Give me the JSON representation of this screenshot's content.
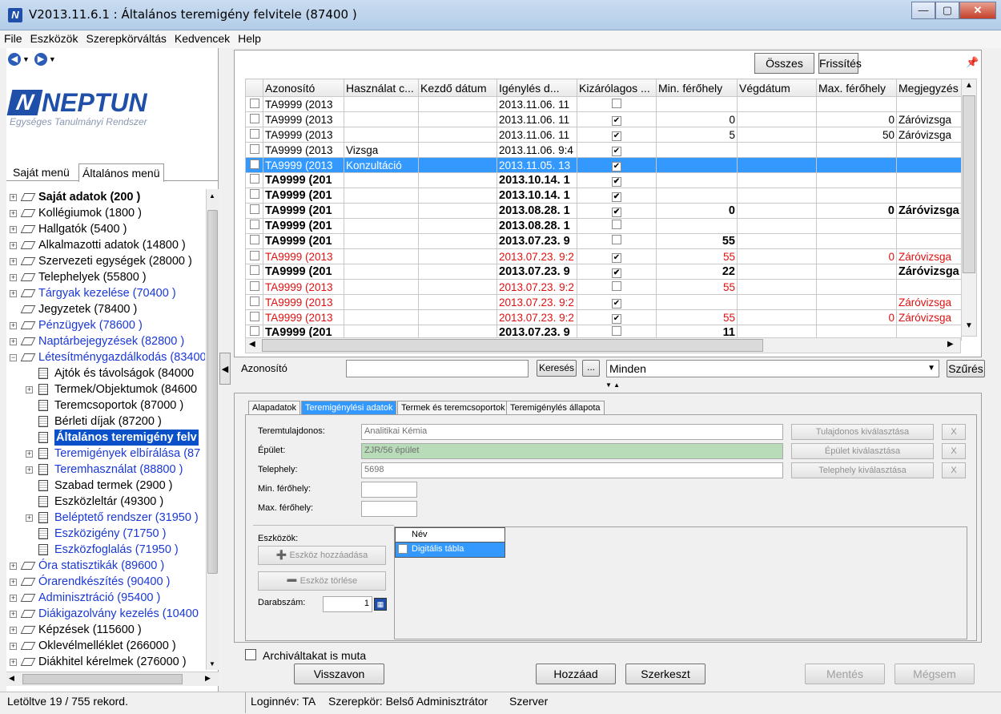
{
  "window": {
    "title": "V2013.11.6.1 : Általános teremigény felvitele (87400  )",
    "minimize": "—",
    "maximize": "▢",
    "close": "✕"
  },
  "menu": [
    "File",
    "Eszközök",
    "Szerepkörváltás",
    "Kedvencek",
    "Help"
  ],
  "logo": {
    "name": "NEPTUN",
    "subtitle": "Egységes Tanulmányi Rendszer"
  },
  "menu_tabs": {
    "own": "Saját menü",
    "general": "Általános menü"
  },
  "tree": [
    {
      "label": "Saját adatok (200  )",
      "style": "bold",
      "level": 0,
      "plus": true,
      "icon": "dia"
    },
    {
      "label": "Kollégiumok (1800  )",
      "style": "",
      "level": 0,
      "plus": true,
      "icon": "dia"
    },
    {
      "label": "Hallgatók (5400  )",
      "style": "",
      "level": 0,
      "plus": true,
      "icon": "dia"
    },
    {
      "label": "Alkalmazotti adatok (14800  )",
      "style": "",
      "level": 0,
      "plus": true,
      "icon": "dia"
    },
    {
      "label": "Szervezeti egységek (28000  )",
      "style": "",
      "level": 0,
      "plus": true,
      "icon": "dia"
    },
    {
      "label": "Telephelyek (55800  )",
      "style": "",
      "level": 0,
      "plus": true,
      "icon": "dia"
    },
    {
      "label": "Tárgyak kezelése (70400  )",
      "style": "blue",
      "level": 0,
      "plus": true,
      "icon": "dia"
    },
    {
      "label": "Jegyzetek (78400  )",
      "style": "",
      "level": 0,
      "plus": false,
      "icon": "dia"
    },
    {
      "label": "Pénzügyek (78600  )",
      "style": "blue",
      "level": 0,
      "plus": true,
      "icon": "dia"
    },
    {
      "label": "Naptárbejegyzések (82800  )",
      "style": "blue",
      "level": 0,
      "plus": true,
      "icon": "dia"
    },
    {
      "label": "Létesítménygazdálkodás (83400",
      "style": "blue",
      "level": 0,
      "plus": true,
      "icon": "dia",
      "open": true
    },
    {
      "label": "Ajtók és távolságok (84000",
      "style": "",
      "level": 1,
      "plus": false,
      "icon": "doc"
    },
    {
      "label": "Termek/Objektumok (84600",
      "style": "",
      "level": 1,
      "plus": true,
      "icon": "doc"
    },
    {
      "label": "Teremcsoportok (87000  )",
      "style": "",
      "level": 1,
      "plus": false,
      "icon": "doc"
    },
    {
      "label": "Bérleti díjak (87200  )",
      "style": "",
      "level": 1,
      "plus": false,
      "icon": "doc"
    },
    {
      "label": "Általános teremigény felv",
      "style": "sel",
      "level": 1,
      "plus": false,
      "icon": "doc"
    },
    {
      "label": "Teremigények elbírálása (87",
      "style": "blue",
      "level": 1,
      "plus": true,
      "icon": "doc"
    },
    {
      "label": "Teremhasználat (88800  )",
      "style": "blue",
      "level": 1,
      "plus": true,
      "icon": "doc"
    },
    {
      "label": "Szabad termek (2900  )",
      "style": "",
      "level": 1,
      "plus": false,
      "icon": "doc"
    },
    {
      "label": "Eszközleltár (49300  )",
      "style": "",
      "level": 1,
      "plus": false,
      "icon": "doc"
    },
    {
      "label": "Beléptető rendszer (31950  )",
      "style": "blue",
      "level": 1,
      "plus": true,
      "icon": "doc"
    },
    {
      "label": "Eszközigény (71750  )",
      "style": "blue",
      "level": 1,
      "plus": false,
      "icon": "doc"
    },
    {
      "label": "Eszközfoglalás (71950  )",
      "style": "blue",
      "level": 1,
      "plus": false,
      "icon": "doc"
    },
    {
      "label": "Óra statisztikák (89600  )",
      "style": "blue",
      "level": 0,
      "plus": true,
      "icon": "dia"
    },
    {
      "label": "Órarendkészítés (90400  )",
      "style": "blue",
      "level": 0,
      "plus": true,
      "icon": "dia"
    },
    {
      "label": "Adminisztráció (95400  )",
      "style": "blue",
      "level": 0,
      "plus": true,
      "icon": "dia"
    },
    {
      "label": "Diákigazolvány kezelés (10400",
      "style": "blue",
      "level": 0,
      "plus": true,
      "icon": "dia"
    },
    {
      "label": "Képzések (115600  )",
      "style": "",
      "level": 0,
      "plus": true,
      "icon": "dia"
    },
    {
      "label": "Oklevélmelléklet (266000  )",
      "style": "",
      "level": 0,
      "plus": true,
      "icon": "dia"
    },
    {
      "label": "Diákhitel kérelmek (276000  )",
      "style": "",
      "level": 0,
      "plus": true,
      "icon": "dia"
    }
  ],
  "grid": {
    "buttons": {
      "all": "Összes ada",
      "refresh": "Frissítés"
    },
    "columns": [
      "Azonosító",
      "Használat c...",
      "Kezdő dátum",
      "Igénylés d...",
      "Kizárólagos ...",
      "Min. férőhely",
      "Végdátum",
      "Max. férőhely",
      "Megjegyzés"
    ],
    "rows": [
      {
        "id": "TA9999 (2013",
        "use": "",
        "start": "",
        "req": "2013.11.06. 11",
        "excl": false,
        "min": "",
        "end": "",
        "max": "",
        "note": "",
        "style": ""
      },
      {
        "id": "TA9999 (2013",
        "use": "",
        "start": "",
        "req": "2013.11.06. 11",
        "excl": true,
        "min": "0",
        "end": "",
        "max": "0",
        "note": "Záróvizsga",
        "style": ""
      },
      {
        "id": "TA9999 (2013",
        "use": "",
        "start": "",
        "req": "2013.11.06. 11",
        "excl": true,
        "min": "5",
        "end": "",
        "max": "50",
        "note": "Záróvizsga",
        "style": ""
      },
      {
        "id": "TA9999 (2013",
        "use": "Vizsga",
        "start": "",
        "req": "2013.11.06. 9:4",
        "excl": true,
        "min": "",
        "end": "",
        "max": "",
        "note": "",
        "style": ""
      },
      {
        "id": "TA9999 (2013",
        "use": "Konzultáció",
        "start": "",
        "req": "2013.11.05. 13",
        "excl": true,
        "min": "",
        "end": "",
        "max": "",
        "note": "",
        "style": "sel"
      },
      {
        "id": "TA9999 (201",
        "use": "",
        "start": "",
        "req": "2013.10.14. 1",
        "excl": true,
        "min": "",
        "end": "",
        "max": "",
        "note": "",
        "style": "bold"
      },
      {
        "id": "TA9999 (201",
        "use": "",
        "start": "",
        "req": "2013.10.14. 1",
        "excl": true,
        "min": "",
        "end": "",
        "max": "",
        "note": "",
        "style": "bold"
      },
      {
        "id": "TA9999 (201",
        "use": "",
        "start": "",
        "req": "2013.08.28. 1",
        "excl": true,
        "min": "0",
        "end": "",
        "max": "0",
        "note": "Záróvizsga",
        "style": "bold"
      },
      {
        "id": "TA9999 (201",
        "use": "",
        "start": "",
        "req": "2013.08.28. 1",
        "excl": false,
        "min": "",
        "end": "",
        "max": "",
        "note": "",
        "style": "bold"
      },
      {
        "id": "TA9999 (201",
        "use": "",
        "start": "",
        "req": "2013.07.23. 9",
        "excl": false,
        "min": "55",
        "end": "",
        "max": "",
        "note": "",
        "style": "bold"
      },
      {
        "id": "TA9999 (2013",
        "use": "",
        "start": "",
        "req": "2013.07.23. 9:2",
        "excl": true,
        "min": "55",
        "end": "",
        "max": "0",
        "note": "Záróvizsga",
        "style": "red"
      },
      {
        "id": "TA9999 (201",
        "use": "",
        "start": "",
        "req": "2013.07.23. 9",
        "excl": true,
        "min": "22",
        "end": "",
        "max": "",
        "note": "Záróvizsga",
        "style": "bold"
      },
      {
        "id": "TA9999 (2013",
        "use": "",
        "start": "",
        "req": "2013.07.23. 9:2",
        "excl": false,
        "min": "55",
        "end": "",
        "max": "",
        "note": "",
        "style": "red"
      },
      {
        "id": "TA9999 (2013",
        "use": "",
        "start": "",
        "req": "2013.07.23. 9:2",
        "excl": true,
        "min": "",
        "end": "",
        "max": "",
        "note": "Záróvizsga",
        "style": "red"
      },
      {
        "id": "TA9999 (2013",
        "use": "",
        "start": "",
        "req": "2013.07.23. 9:2",
        "excl": true,
        "min": "55",
        "end": "",
        "max": "0",
        "note": "Záróvizsga",
        "style": "red"
      },
      {
        "id": "TA9999 (201",
        "use": "",
        "start": "",
        "req": "2013.07.23. 9",
        "excl": false,
        "min": "11",
        "end": "",
        "max": "",
        "note": "",
        "style": "bold"
      }
    ]
  },
  "filter": {
    "label": "Azonosító",
    "search": "Keresés",
    "dots": "...",
    "select": "Minden",
    "filter_btn": "Szűrés"
  },
  "form": {
    "tabs": [
      "Alapadatok",
      "Teremigénylési adatok",
      "Termek és teremcsoportok",
      "Teremigénylés állapota"
    ],
    "owner_label": "Teremtulajdonos:",
    "owner_value": "Analitikai Kémia",
    "owner_btn": "Tulajdonos kiválasztása",
    "building_label": "Épület:",
    "building_value": "ZJR/56 épület",
    "building_btn": "Épület kiválasztása",
    "site_label": "Telephely:",
    "site_value": "5698",
    "site_btn": "Telephely kiválasztása",
    "clear": "X",
    "min_label": "Min. férőhely:",
    "max_label": "Max. férőhely:",
    "tools_label": "Eszközök:",
    "add_tool": "Eszköz hozzáadása",
    "del_tool": "Eszköz törlése",
    "count_label": "Darabszám:",
    "count_value": "1",
    "tools_col": "Név",
    "tools_row": "Digitális tábla"
  },
  "archive": "Archiváltakat is muta",
  "actions": {
    "undo": "Visszavon",
    "add": "Hozzáad",
    "edit": "Szerkeszt",
    "save": "Mentés",
    "cancel": "Mégsem"
  },
  "status": {
    "loaded": "Letöltve 19 / 755 rekord.",
    "login": "Loginnév: TA",
    "role": "Szerepkör: Belső Adminisztrátor",
    "server": "Szerver"
  }
}
